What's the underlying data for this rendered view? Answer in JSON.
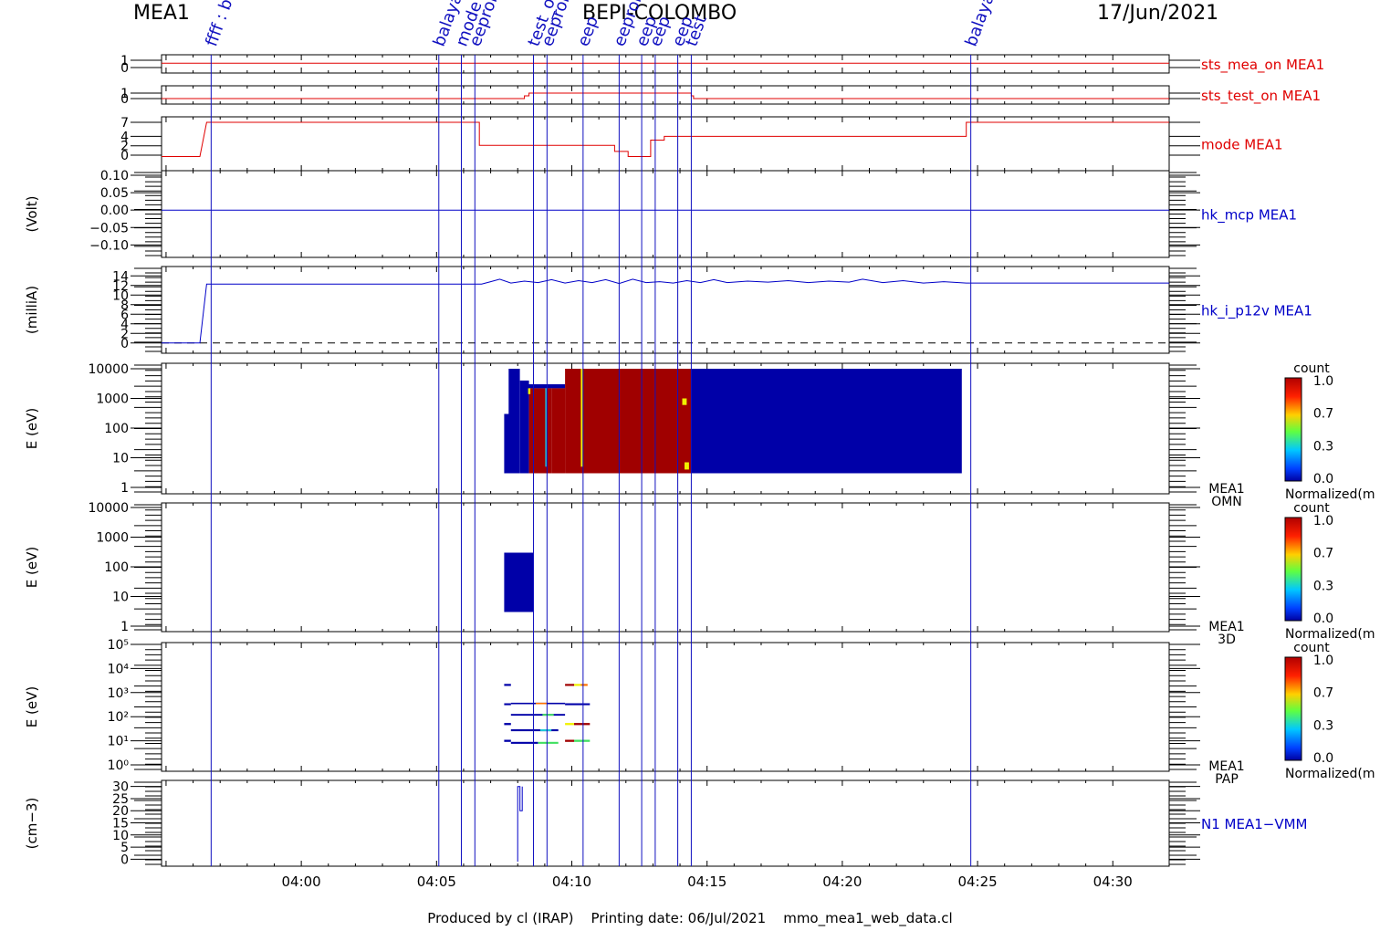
{
  "header": {
    "left_label": "MEA1",
    "center_title": "BEPI-COLOMBO",
    "date": "17/Jun/2021"
  },
  "footer": {
    "text": "Produced by cl (IRAP)    Printing date: 06/Jul/2021    mmo_mea1_web_data.cl"
  },
  "colors": {
    "red_trace": "#e00000",
    "blue_trace": "#0000c8",
    "spectrogram_blue": "#0000a8",
    "spectrogram_red": "#a00000",
    "event_line": "#1010c0"
  },
  "chart_data": {
    "type": "time-series stack",
    "time_axis": {
      "ticks": [
        "04:00",
        "04:05",
        "04:10",
        "04:15",
        "04:20",
        "04:25",
        "04:30"
      ],
      "range": [
        "03:54:50",
        "04:32:05"
      ]
    },
    "event_markers": [
      {
        "time": "03:56:40",
        "label": "ffff : b"
      },
      {
        "time": "04:05:05",
        "label": "balaya"
      },
      {
        "time": "04:05:55",
        "label": "mode"
      },
      {
        "time": "04:06:25",
        "label": "eeprom"
      },
      {
        "time": "04:08:35",
        "label": "test_o"
      },
      {
        "time": "04:09:05",
        "label": "eeprom"
      },
      {
        "time": "04:10:25",
        "label": "eep"
      },
      {
        "time": "04:11:45",
        "label": "eeprom"
      },
      {
        "time": "04:12:35",
        "label": "eep"
      },
      {
        "time": "04:13:05",
        "label": "eep"
      },
      {
        "time": "04:13:55",
        "label": "eep"
      },
      {
        "time": "04:14:25",
        "label": "test"
      },
      {
        "time": "04:24:45",
        "label": "balayag"
      }
    ],
    "panels": [
      {
        "name": "sts_mea_on MEA1",
        "type": "line",
        "ylabel": "",
        "ticks": [
          "1",
          "0"
        ],
        "ylim": [
          0,
          1
        ],
        "points": [
          [
            "03:54:50",
            0.6
          ],
          [
            "04:32:05",
            0.6
          ]
        ]
      },
      {
        "name": "sts_test_on MEA1",
        "type": "line",
        "ylabel": "",
        "ticks": [
          "1",
          "0"
        ],
        "ylim": [
          0,
          1
        ],
        "points": [
          [
            "03:54:50",
            0
          ],
          [
            "04:08:15",
            0
          ],
          [
            "04:08:15",
            0.5
          ],
          [
            "04:08:25",
            0.5
          ],
          [
            "04:08:25",
            1
          ],
          [
            "04:14:25",
            1
          ],
          [
            "04:14:25",
            0.5
          ],
          [
            "04:14:30",
            0.5
          ],
          [
            "04:14:30",
            0
          ],
          [
            "04:32:05",
            0
          ]
        ]
      },
      {
        "name": "mode MEA1",
        "type": "line",
        "ylabel": "",
        "ticks": [
          "7",
          "4",
          "2",
          "0"
        ],
        "ylim": [
          0,
          7
        ],
        "points": [
          [
            "03:54:50",
            -0.3
          ],
          [
            "03:56:15",
            -0.3
          ],
          [
            "03:56:30",
            7
          ],
          [
            "04:06:35",
            7
          ],
          [
            "04:06:35",
            2.1
          ],
          [
            "04:11:35",
            2.1
          ],
          [
            "04:11:35",
            0.8
          ],
          [
            "04:12:05",
            0.8
          ],
          [
            "04:12:05",
            -0.3
          ],
          [
            "04:12:55",
            -0.3
          ],
          [
            "04:12:55",
            3.2
          ],
          [
            "04:13:25",
            3.2
          ],
          [
            "04:13:25",
            4
          ],
          [
            "04:24:35",
            4
          ],
          [
            "04:24:35",
            7
          ],
          [
            "04:32:05",
            7
          ]
        ]
      },
      {
        "name": "hk_mcp MEA1",
        "type": "line",
        "ylabel": "(Volt)",
        "ticks": [
          "0.10",
          "0.05",
          "0.00",
          "−0.05",
          "−0.10"
        ],
        "ylim": [
          -0.12,
          0.1
        ],
        "points": [
          [
            "03:54:50",
            0
          ],
          [
            "04:32:05",
            0
          ]
        ]
      },
      {
        "name": "hk_i_p12v MEA1",
        "type": "line",
        "ylabel": "(milliA)",
        "ticks": [
          "14",
          "12",
          "10",
          "8",
          "6",
          "4",
          "2",
          "0"
        ],
        "ylim": [
          -1,
          15
        ],
        "reference_zero": "dashed",
        "points": [
          [
            "03:54:50",
            0
          ],
          [
            "03:56:15",
            0
          ],
          [
            "03:56:30",
            12.3
          ],
          [
            "04:06:40",
            12.3
          ],
          [
            "04:07:00",
            12.8
          ],
          [
            "04:07:20",
            13.3
          ],
          [
            "04:07:45",
            12.5
          ],
          [
            "04:08:15",
            12.9
          ],
          [
            "04:08:45",
            12.6
          ],
          [
            "04:09:15",
            13.2
          ],
          [
            "04:09:45",
            12.5
          ],
          [
            "04:10:15",
            13.0
          ],
          [
            "04:10:45",
            12.6
          ],
          [
            "04:11:15",
            13.2
          ],
          [
            "04:11:45",
            12.4
          ],
          [
            "04:12:15",
            13.3
          ],
          [
            "04:12:45",
            12.6
          ],
          [
            "04:13:15",
            12.8
          ],
          [
            "04:13:45",
            12.5
          ],
          [
            "04:14:15",
            13.0
          ],
          [
            "04:14:45",
            12.6
          ],
          [
            "04:15:15",
            13.2
          ],
          [
            "04:15:45",
            12.6
          ],
          [
            "04:16:30",
            12.9
          ],
          [
            "04:17:15",
            12.7
          ],
          [
            "04:18:00",
            13.0
          ],
          [
            "04:18:45",
            12.6
          ],
          [
            "04:19:30",
            12.9
          ],
          [
            "04:20:15",
            12.7
          ],
          [
            "04:20:45",
            13.3
          ],
          [
            "04:21:30",
            12.6
          ],
          [
            "04:22:15",
            13.0
          ],
          [
            "04:23:00",
            12.5
          ],
          [
            "04:23:45",
            12.8
          ],
          [
            "04:24:35",
            12.5
          ],
          [
            "04:32:05",
            12.5
          ]
        ]
      },
      {
        "name": "MEA1 OMN",
        "type": "heatmap",
        "ylabel": "E (eV)",
        "yscale": "log",
        "ticks": [
          "10000",
          "1000",
          "100",
          "10",
          "1"
        ],
        "ylim": [
          1,
          10000
        ],
        "cells": [
          [
            "04:07:30",
            "04:07:45",
            3,
            300,
            "blue"
          ],
          [
            "04:07:40",
            "04:08:05",
            3,
            10000,
            "blue"
          ],
          [
            "04:08:05",
            "04:08:25",
            3,
            4000,
            "blue"
          ],
          [
            "04:08:15",
            "04:09:45",
            2200,
            3000,
            "blue"
          ],
          [
            "04:08:25",
            "04:09:15",
            3,
            2200,
            "red"
          ],
          [
            "04:09:15",
            "04:09:45",
            3,
            2200,
            "red"
          ],
          [
            "04:09:45",
            "04:14:25",
            3,
            10000,
            "red"
          ],
          [
            "04:14:25",
            "04:24:25",
            3,
            10000,
            "blue"
          ],
          [
            "04:08:23",
            "04:08:28",
            1400,
            2200,
            "yellow"
          ],
          [
            "04:09:01",
            "04:09:05",
            5,
            2200,
            "cyan"
          ],
          [
            "04:10:20",
            "04:10:24",
            5,
            10000,
            "yellow"
          ],
          [
            "04:14:05",
            "04:14:15",
            600,
            1000,
            "yellow"
          ],
          [
            "04:14:10",
            "04:14:20",
            4,
            7,
            "yellow"
          ]
        ]
      },
      {
        "name": "MEA1 3D",
        "type": "heatmap",
        "ylabel": "E (eV)",
        "yscale": "log",
        "ticks": [
          "10000",
          "1000",
          "100",
          "10",
          "1"
        ],
        "ylim": [
          1,
          10000
        ],
        "cells": [
          [
            "04:07:30",
            "04:08:35",
            3,
            300,
            "blue"
          ]
        ]
      },
      {
        "name": "MEA1 PAP",
        "type": "heatmap",
        "ylabel": "E (eV)",
        "yscale": "log",
        "ticks": [
          "10⁵",
          "10⁴",
          "10³",
          "10²",
          "10¹",
          "10⁰"
        ],
        "ylim": [
          1,
          100000
        ],
        "cells": [
          [
            "04:07:30",
            "04:07:45",
            1900,
            2300,
            "blue"
          ],
          [
            "04:09:45",
            "04:10:05",
            1900,
            2300,
            "red"
          ],
          [
            "04:10:05",
            "04:10:20",
            1900,
            2300,
            "yellow"
          ],
          [
            "04:10:20",
            "04:10:35",
            1900,
            2300,
            "orange"
          ],
          [
            "04:07:30",
            "04:07:45",
            300,
            360,
            "blue"
          ],
          [
            "04:07:45",
            "04:09:45",
            330,
            380,
            "blue"
          ],
          [
            "04:08:40",
            "04:09:05",
            330,
            380,
            "orange"
          ],
          [
            "04:09:45",
            "04:10:40",
            300,
            360,
            "blue"
          ],
          [
            "04:07:45",
            "04:09:45",
            110,
            130,
            "blue"
          ],
          [
            "04:08:55",
            "04:09:20",
            110,
            130,
            "green"
          ],
          [
            "04:07:30",
            "04:07:45",
            45,
            55,
            "blue"
          ],
          [
            "04:09:45",
            "04:10:05",
            45,
            55,
            "yellow"
          ],
          [
            "04:10:05",
            "04:10:40",
            45,
            55,
            "red"
          ],
          [
            "04:07:45",
            "04:09:30",
            25,
            30,
            "blue"
          ],
          [
            "04:08:50",
            "04:09:15",
            25,
            30,
            "cyan"
          ],
          [
            "04:07:30",
            "04:07:45",
            9,
            11,
            "blue"
          ],
          [
            "04:07:45",
            "04:08:45",
            7.5,
            9,
            "blue"
          ],
          [
            "04:08:45",
            "04:09:30",
            7.5,
            9,
            "green"
          ],
          [
            "04:09:45",
            "04:10:05",
            9,
            11,
            "red"
          ],
          [
            "04:10:05",
            "04:10:40",
            9,
            11,
            "green"
          ]
        ]
      },
      {
        "name": "N1 MEA1−VMM",
        "type": "line",
        "ylabel": "(cm−3)",
        "ticks": [
          "30",
          "25",
          "20",
          "15",
          "10",
          "5",
          "0"
        ],
        "ylim": [
          -1,
          31
        ],
        "points": [
          [
            "04:08:00",
            -1
          ],
          [
            "04:08:00",
            30
          ],
          [
            "04:08:05",
            30
          ],
          [
            "04:08:05",
            20
          ],
          [
            "04:08:10",
            20
          ],
          [
            "04:08:10",
            30
          ]
        ]
      }
    ],
    "colorbars": [
      {
        "title": "count",
        "ticks": [
          "1.0",
          "0.7",
          "0.3",
          "0.0"
        ],
        "range": [
          0,
          1
        ],
        "label": "Normalized(m"
      },
      {
        "title": "count",
        "ticks": [
          "1.0",
          "0.7",
          "0.3",
          "0.0"
        ],
        "range": [
          0,
          1
        ],
        "label": "Normalized(m"
      },
      {
        "title": "count",
        "ticks": [
          "1.0",
          "0.7",
          "0.3",
          "0.0"
        ],
        "range": [
          0,
          1
        ],
        "label": "Normalized(m"
      }
    ]
  }
}
